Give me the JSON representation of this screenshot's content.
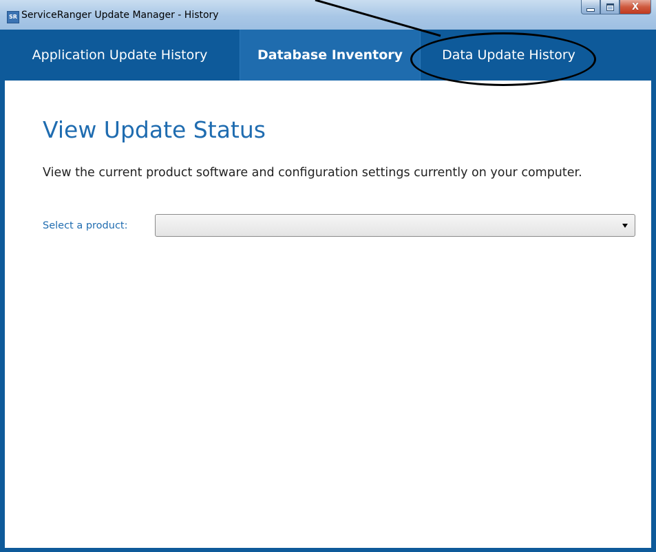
{
  "window": {
    "title": "ServiceRanger Update Manager - History",
    "app_icon_text": "SR",
    "close_glyph": "X"
  },
  "tabs": [
    {
      "label": "Application Update History",
      "selected": false
    },
    {
      "label": "Database Inventory",
      "selected": true
    },
    {
      "label": "Data Update History",
      "selected": false
    }
  ],
  "main": {
    "heading": "View Update Status",
    "description": "View the current product software and configuration settings currently on your computer.",
    "select_label": "Select a product:",
    "select_value": ""
  },
  "colors": {
    "tab_bar": "#0e5a9a",
    "tab_selected": "#1f6cae",
    "accent_text": "#1f6cb0"
  },
  "icons": [
    "app-icon",
    "minimize-icon",
    "maximize-icon",
    "close-icon",
    "dropdown-arrow-icon"
  ]
}
